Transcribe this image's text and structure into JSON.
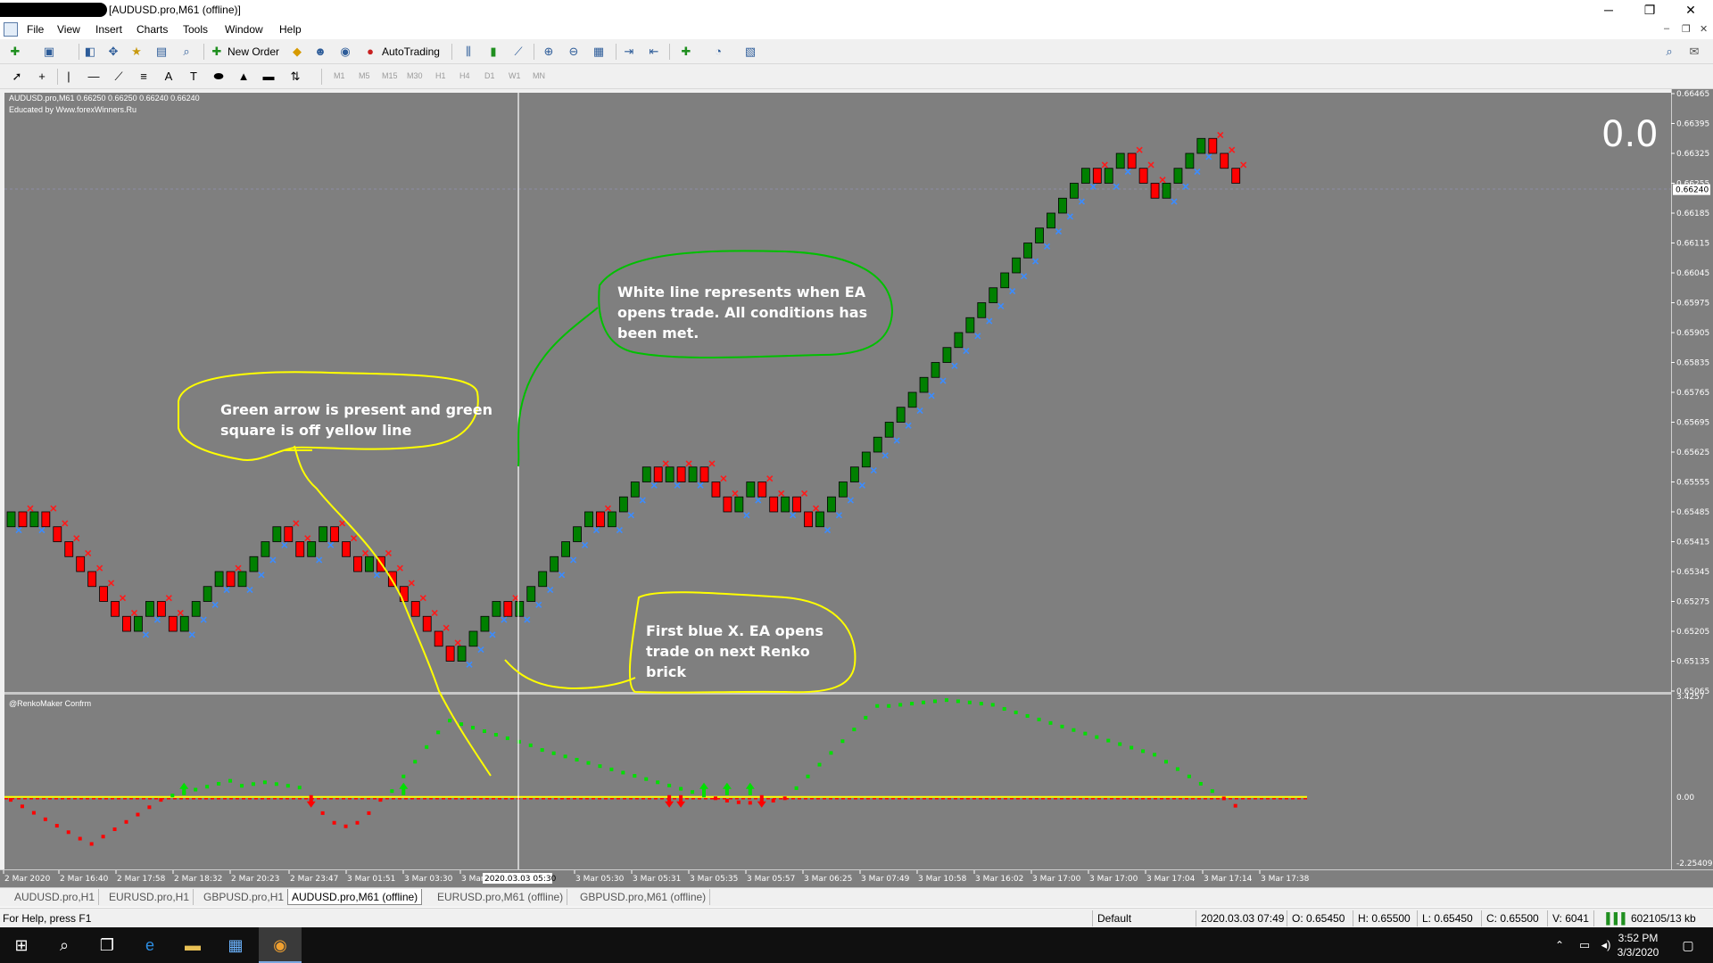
{
  "window": {
    "title": "[AUDUSD.pro,M61 (offline)]",
    "minimize": "─",
    "maximize": "❐",
    "close": "✕"
  },
  "menu": [
    "File",
    "View",
    "Insert",
    "Charts",
    "Tools",
    "Window",
    "Help"
  ],
  "toolbar": {
    "new_order": "New Order",
    "autotrading": "AutoTrading"
  },
  "timeframes": [
    "M1",
    "M5",
    "M15",
    "M30",
    "H1",
    "H4",
    "D1",
    "W1",
    "MN"
  ],
  "chart": {
    "symbol_line": "AUDUSD.pro,M61  0.66250 0.66250 0.66240 0.66240",
    "educated_line": "Educated by Www.forexWinners.Ru",
    "big_value": "0.0",
    "indicator_name": "@RenkoMaker Confrm",
    "price_labels": [
      "0.66465",
      "0.66395",
      "0.66325",
      "0.66255",
      "0.66185",
      "0.66115",
      "0.66045",
      "0.65975",
      "0.65905",
      "0.65835",
      "0.65765",
      "0.65695",
      "0.65625",
      "0.65555",
      "0.65485",
      "0.65415",
      "0.65345",
      "0.65275",
      "0.65205",
      "0.65135",
      "0.65065"
    ],
    "current_price": "0.66240",
    "sub_labels": [
      "3.4257",
      "0.00",
      "-2.25409"
    ],
    "time_labels": [
      "2 Mar 2020",
      "2 Mar 16:40",
      "2 Mar 17:58",
      "2 Mar 18:32",
      "2 Mar 20:23",
      "2 Mar 23:47",
      "3 Mar 01:51",
      "3 Mar 03:30",
      "3 Mar",
      "3 Mar 05:30",
      "3 Mar 05:31",
      "3 Mar 05:35",
      "3 Mar 05:57",
      "3 Mar 06:25",
      "3 Mar 07:49",
      "3 Mar 10:58",
      "3 Mar 16:02",
      "3 Mar 17:00",
      "3 Mar 17:00",
      "3 Mar 17:04",
      "3 Mar 17:14",
      "3 Mar 17:38"
    ],
    "cursor_time": "2020.03.03 05:30",
    "colors": {
      "bull": "#008000",
      "bear": "#ff0000",
      "bg": "#7f7f7f",
      "annot_yellow": "#ffff00",
      "annot_green": "#00c000",
      "blue_x": "#3c8cff",
      "red_x": "#ff1a1a"
    }
  },
  "annotations": {
    "green_arrow": [
      "Green arrow is present and green",
      "square is off yellow line"
    ],
    "white_line": [
      "White line represents when EA",
      "opens trade. All conditions has",
      "been met."
    ],
    "first_blue": [
      "First blue X. EA opens",
      "trade on next Renko",
      "brick"
    ]
  },
  "tabs": [
    "AUDUSD.pro,H1",
    "EURUSD.pro,H1",
    "GBPUSD.pro,H1",
    "AUDUSD.pro,M61 (offline)",
    "EURUSD.pro,M61 (offline)",
    "GBPUSD.pro,M61 (offline)"
  ],
  "status": {
    "help": "For Help, press F1",
    "profile": "Default",
    "datetime": "2020.03.03 07:49",
    "open": "O: 0.65450",
    "high": "H: 0.65500",
    "low": "L: 0.65450",
    "close": "C: 0.65500",
    "volume": "V: 6041",
    "traffic": "602105/13 kb"
  },
  "taskbar": {
    "time": "3:52 PM",
    "date": "3/3/2020"
  }
}
